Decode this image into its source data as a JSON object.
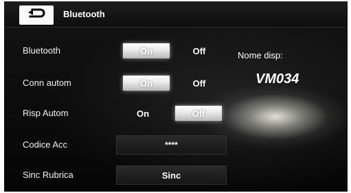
{
  "header": {
    "back_icon": "return-arrow-icon",
    "title": "Bluetooth"
  },
  "rows": {
    "bluetooth": {
      "label": "Bluetooth",
      "on_label": "On",
      "off_label": "Off",
      "selected": "On"
    },
    "conn_autom": {
      "label": "Conn autom",
      "on_label": "On",
      "off_label": "Off",
      "selected": "On"
    },
    "risp_autom": {
      "label": "Risp Autom",
      "on_label": "On",
      "off_label": "Off",
      "selected": "Off"
    },
    "codice_acc": {
      "label": "Codice Acc",
      "value": "****"
    },
    "sinc_rubrica": {
      "label": "Sinc Rubrica",
      "button_label": "Sinc"
    }
  },
  "device": {
    "label": "Nome disp:",
    "name": "VM034"
  },
  "colors": {
    "background": "#0b0b0b",
    "text": "#ffffff",
    "active_toggle": "#f0f0f0"
  }
}
